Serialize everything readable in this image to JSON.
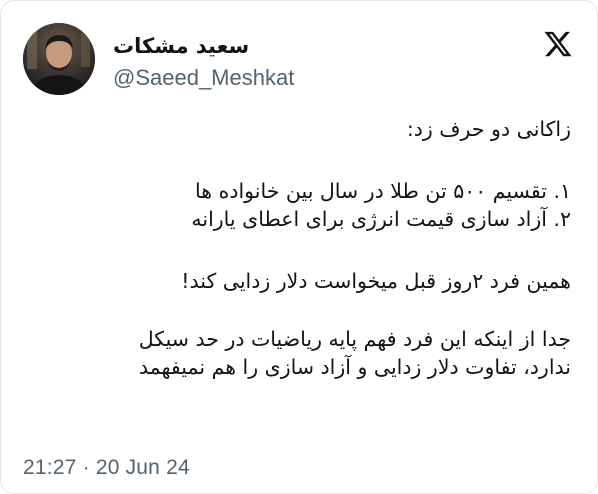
{
  "author": {
    "display_name": "سعید مشکات",
    "handle": "@Saeed_Meshkat",
    "avatar_icon": "profile-photo"
  },
  "brand": {
    "logo_icon": "x-logo-icon",
    "logo_color": "#0f1419"
  },
  "tweet": {
    "lines": [
      "زاکانی دو حرف زد:",
      "۱. تقسیم ۵۰۰ تن طلا در سال بین خانواده ها",
      "۲. آزاد سازی قیمت انرژی برای اعطای یارانه",
      "همین فرد ۲روز قبل میخواست دلار زدایی کند!",
      "جدا از اینکه این فرد فهم پایه ریاضیات در حد سیکل",
      "ندارد، تفاوت دلار زدایی و آزاد سازی را هم نمیفهمد"
    ],
    "timestamp": "21:27 · 20 Jun 24"
  },
  "colors": {
    "text_primary": "#0f1419",
    "text_secondary": "#536471",
    "border": "#e6e6e6"
  }
}
